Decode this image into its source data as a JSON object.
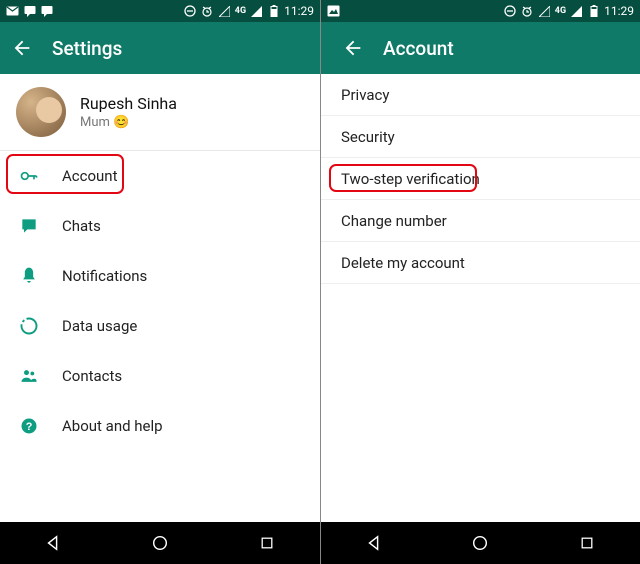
{
  "status": {
    "time": "11:29",
    "network_label": "4G"
  },
  "left": {
    "title": "Settings",
    "profile": {
      "name": "Rupesh Sinha",
      "status": "Mum 😊"
    },
    "items": [
      {
        "label": "Account"
      },
      {
        "label": "Chats"
      },
      {
        "label": "Notifications"
      },
      {
        "label": "Data usage"
      },
      {
        "label": "Contacts"
      },
      {
        "label": "About and help"
      }
    ]
  },
  "right": {
    "title": "Account",
    "items": [
      {
        "label": "Privacy"
      },
      {
        "label": "Security"
      },
      {
        "label": "Two-step verification"
      },
      {
        "label": "Change number"
      },
      {
        "label": "Delete my account"
      }
    ]
  }
}
